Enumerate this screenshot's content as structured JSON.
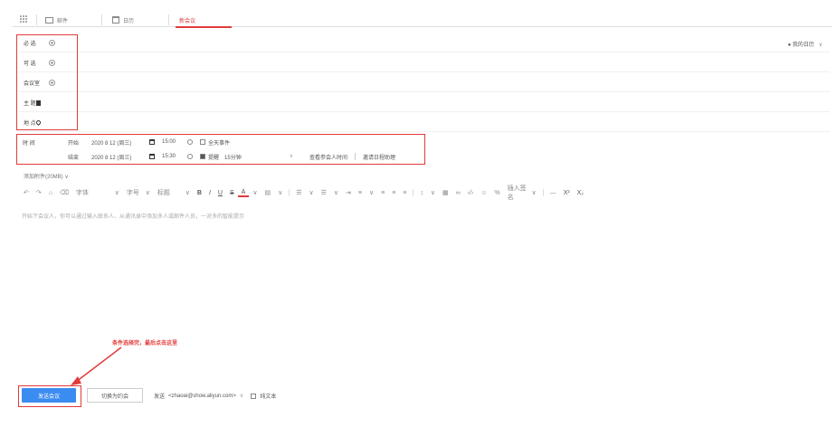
{
  "tabs": [
    {
      "label": "邮件",
      "icon": "mail-icon"
    },
    {
      "label": "日历",
      "icon": "calendar-icon"
    },
    {
      "label": "新会议",
      "active": true
    }
  ],
  "apps_icon": "grid-icon",
  "calendar_selector": "● 我的日历",
  "fields": {
    "required": "必 选",
    "optional": "可 选",
    "rooms": "会议室",
    "subject": "主 题",
    "location": "地 点"
  },
  "time": {
    "label": "时 间",
    "start_label": "开始",
    "start_date": "2020 8 12 (周三)",
    "start_time": "15:00",
    "allday": "全天事件",
    "end_label": "结束",
    "end_date": "2020 8 12 (周三)",
    "end_time": "15:30",
    "reminder_label": "提醒",
    "reminder_value": "15分钟",
    "find_time": "查看参会人时间",
    "schedule_assistant": "邀请日程助理"
  },
  "attach_link": "添加附件(20MB) ∨",
  "toolbar": {
    "font_name": "字体",
    "font_size": "字号",
    "heading": "标题",
    "insert": "插入签名"
  },
  "editor_placeholder": "开始下会议人，你可以通过输入联系人、从通讯录中添加多人或邮件人员，一对多的智能提示",
  "annotation": "条件选择完，最后点击这里",
  "bottom": {
    "send_button": "发送会议",
    "switch_button": "切换为约会",
    "sender_label": "发送",
    "sender": "<zhaoai@show.aliyun.com>",
    "plain_text": "纯文本"
  },
  "colors": {
    "accent": "#e03b3b",
    "primary": "#3b8cf0",
    "annotation": "#e23a3a"
  }
}
